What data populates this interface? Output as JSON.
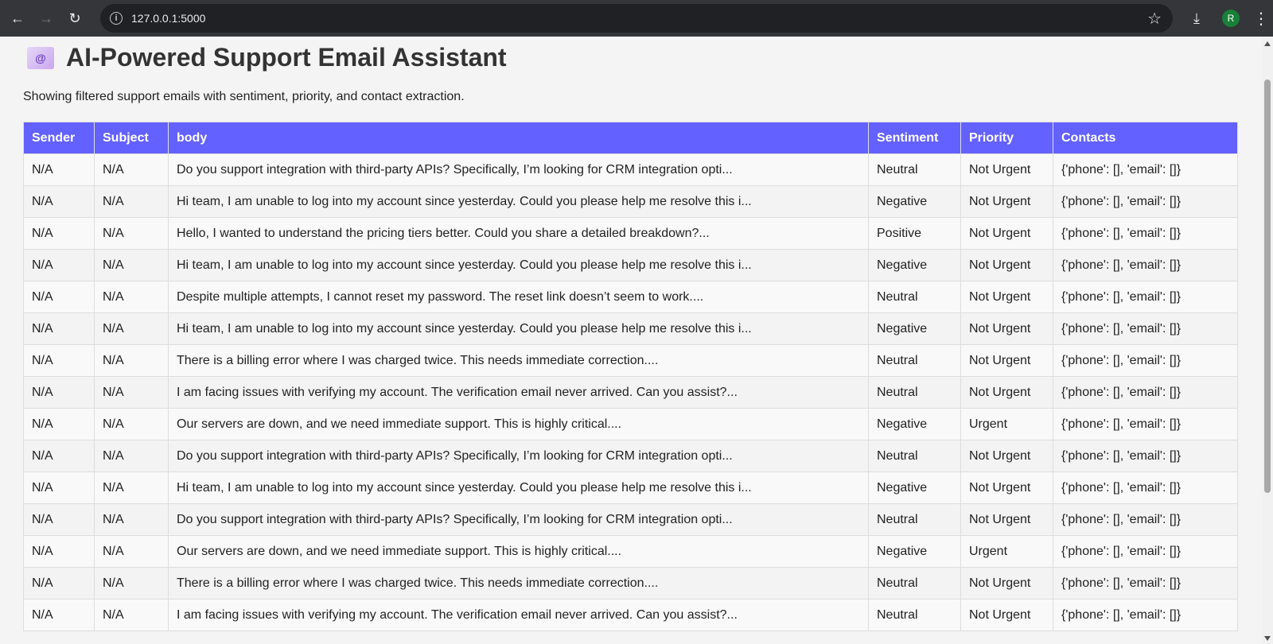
{
  "browser": {
    "url": "127.0.0.1:5000",
    "profile_initial": "R"
  },
  "page": {
    "title": "AI-Powered Support Email Assistant",
    "subtitle": "Showing filtered support emails with sentiment, priority, and contact extraction.",
    "icon": "mail-icon"
  },
  "table": {
    "headers": {
      "sender": "Sender",
      "subject": "Subject",
      "body": "body",
      "sentiment": "Sentiment",
      "priority": "Priority",
      "contacts": "Contacts"
    },
    "header_color": "#6361ff",
    "rows": [
      {
        "sender": "N/A",
        "subject": "N/A",
        "body": "Do you support integration with third-party APIs? Specifically, I’m looking for CRM integration opti...",
        "sentiment": "Neutral",
        "priority": "Not Urgent",
        "contacts": "{'phone': [], 'email': []}"
      },
      {
        "sender": "N/A",
        "subject": "N/A",
        "body": "Hi team, I am unable to log into my account since yesterday. Could you please help me resolve this i...",
        "sentiment": "Negative",
        "priority": "Not Urgent",
        "contacts": "{'phone': [], 'email': []}"
      },
      {
        "sender": "N/A",
        "subject": "N/A",
        "body": "Hello, I wanted to understand the pricing tiers better. Could you share a detailed breakdown?...",
        "sentiment": "Positive",
        "priority": "Not Urgent",
        "contacts": "{'phone': [], 'email': []}"
      },
      {
        "sender": "N/A",
        "subject": "N/A",
        "body": "Hi team, I am unable to log into my account since yesterday. Could you please help me resolve this i...",
        "sentiment": "Negative",
        "priority": "Not Urgent",
        "contacts": "{'phone': [], 'email': []}"
      },
      {
        "sender": "N/A",
        "subject": "N/A",
        "body": "Despite multiple attempts, I cannot reset my password. The reset link doesn’t seem to work....",
        "sentiment": "Neutral",
        "priority": "Not Urgent",
        "contacts": "{'phone': [], 'email': []}"
      },
      {
        "sender": "N/A",
        "subject": "N/A",
        "body": "Hi team, I am unable to log into my account since yesterday. Could you please help me resolve this i...",
        "sentiment": "Negative",
        "priority": "Not Urgent",
        "contacts": "{'phone': [], 'email': []}"
      },
      {
        "sender": "N/A",
        "subject": "N/A",
        "body": "There is a billing error where I was charged twice. This needs immediate correction....",
        "sentiment": "Neutral",
        "priority": "Not Urgent",
        "contacts": "{'phone': [], 'email': []}"
      },
      {
        "sender": "N/A",
        "subject": "N/A",
        "body": "I am facing issues with verifying my account. The verification email never arrived. Can you assist?...",
        "sentiment": "Neutral",
        "priority": "Not Urgent",
        "contacts": "{'phone': [], 'email': []}"
      },
      {
        "sender": "N/A",
        "subject": "N/A",
        "body": "Our servers are down, and we need immediate support. This is highly critical....",
        "sentiment": "Negative",
        "priority": "Urgent",
        "contacts": "{'phone': [], 'email': []}"
      },
      {
        "sender": "N/A",
        "subject": "N/A",
        "body": "Do you support integration with third-party APIs? Specifically, I’m looking for CRM integration opti...",
        "sentiment": "Neutral",
        "priority": "Not Urgent",
        "contacts": "{'phone': [], 'email': []}"
      },
      {
        "sender": "N/A",
        "subject": "N/A",
        "body": "Hi team, I am unable to log into my account since yesterday. Could you please help me resolve this i...",
        "sentiment": "Negative",
        "priority": "Not Urgent",
        "contacts": "{'phone': [], 'email': []}"
      },
      {
        "sender": "N/A",
        "subject": "N/A",
        "body": "Do you support integration with third-party APIs? Specifically, I’m looking for CRM integration opti...",
        "sentiment": "Neutral",
        "priority": "Not Urgent",
        "contacts": "{'phone': [], 'email': []}"
      },
      {
        "sender": "N/A",
        "subject": "N/A",
        "body": "Our servers are down, and we need immediate support. This is highly critical....",
        "sentiment": "Negative",
        "priority": "Urgent",
        "contacts": "{'phone': [], 'email': []}"
      },
      {
        "sender": "N/A",
        "subject": "N/A",
        "body": "There is a billing error where I was charged twice. This needs immediate correction....",
        "sentiment": "Neutral",
        "priority": "Not Urgent",
        "contacts": "{'phone': [], 'email': []}"
      },
      {
        "sender": "N/A",
        "subject": "N/A",
        "body": "I am facing issues with verifying my account. The verification email never arrived. Can you assist?...",
        "sentiment": "Neutral",
        "priority": "Not Urgent",
        "contacts": "{'phone': [], 'email': []}"
      }
    ]
  }
}
